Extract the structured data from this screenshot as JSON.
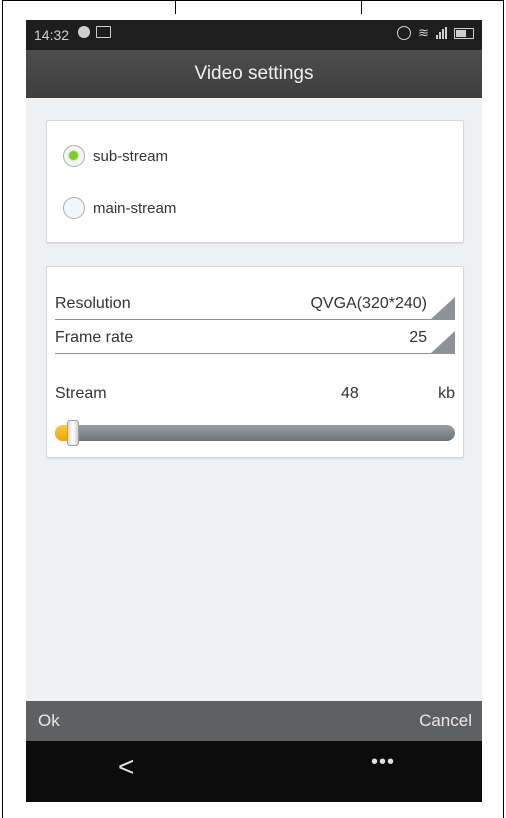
{
  "status_bar": {
    "time": "14:32",
    "icons_left": [
      "notification-dot-icon",
      "image-icon"
    ],
    "icons_right": [
      "alarm-icon",
      "wifi-icon",
      "signal-icon",
      "battery-icon"
    ]
  },
  "header": {
    "title": "Video settings"
  },
  "stream_options": [
    {
      "label": "sub-stream",
      "checked": true
    },
    {
      "label": "main-stream",
      "checked": false
    }
  ],
  "settings": {
    "resolution": {
      "label": "Resolution",
      "value": "QVGA(320*240)"
    },
    "frame_rate": {
      "label": "Frame rate",
      "value": "25"
    },
    "stream": {
      "label": "Stream",
      "value": "48",
      "unit": "kb",
      "level_fraction": 0.03
    }
  },
  "actions": {
    "ok_label": "Ok",
    "cancel_label": "Cancel"
  },
  "nav": {
    "back_glyph": "<",
    "menu_glyph": "•••"
  },
  "colors": {
    "accent_radio": "#7ecb2a",
    "slider_fill": "#f0a500",
    "title_bar": "#454545",
    "action_bar": "#5e6062"
  }
}
